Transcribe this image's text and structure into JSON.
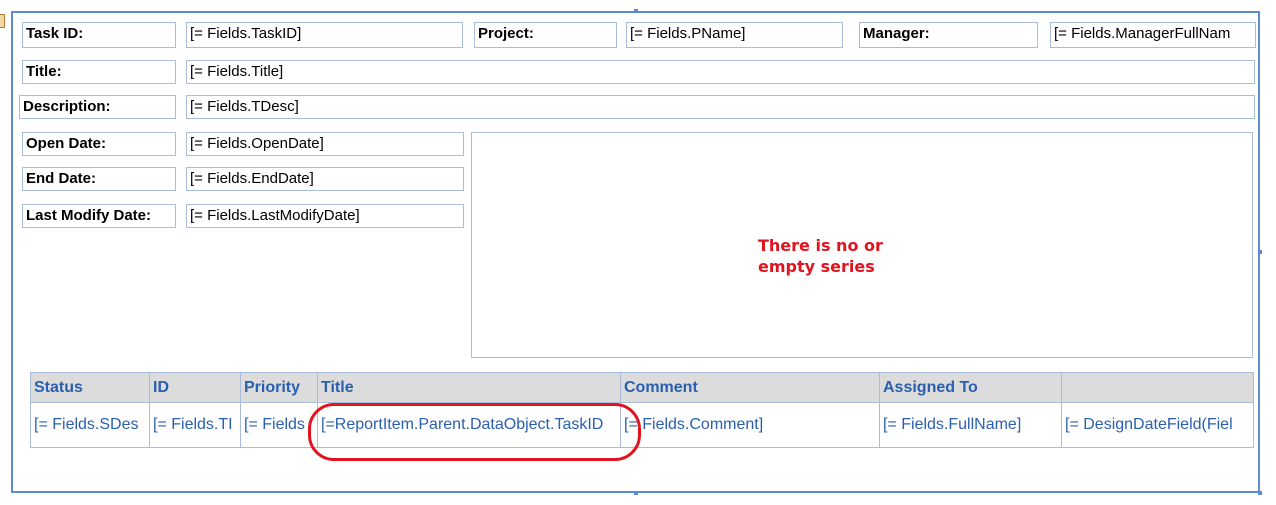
{
  "header_fields": {
    "task_id_label": "Task ID:",
    "task_id_value": "[= Fields.TaskID]",
    "project_label": "Project:",
    "project_value": "[= Fields.PName]",
    "manager_label": "Manager:",
    "manager_value": "[= Fields.ManagerFullNam"
  },
  "detail_fields": {
    "title_label": "Title:",
    "title_value": "[= Fields.Title]",
    "description_label": "Description:",
    "description_value": "[= Fields.TDesc]",
    "open_date_label": "Open Date:",
    "open_date_value": "[= Fields.OpenDate]",
    "end_date_label": "End Date:",
    "end_date_value": "[= Fields.EndDate]",
    "last_modify_label": "Last Modify Date:",
    "last_modify_value": "[= Fields.LastModifyDate]"
  },
  "chart": {
    "message_line1": "There is no or",
    "message_line2": "empty series"
  },
  "table": {
    "headers": [
      "Status",
      "ID",
      "Priority",
      "Title",
      "Comment",
      "Assigned To",
      ""
    ],
    "row": [
      "[= Fields.SDes",
      "[= Fields.TI",
      "[= Fields",
      "[=ReportItem.Parent.DataObject.TaskID",
      "[= Fields.Comment]",
      "[= Fields.FullName]",
      "[= DesignDateField(Fiel"
    ]
  },
  "colors": {
    "selection_border": "#5b8bd6",
    "field_border": "#a9bcd9",
    "header_bg": "#dcdcdc",
    "table_text": "#2a5fb0",
    "alert_red": "#e0141e"
  }
}
